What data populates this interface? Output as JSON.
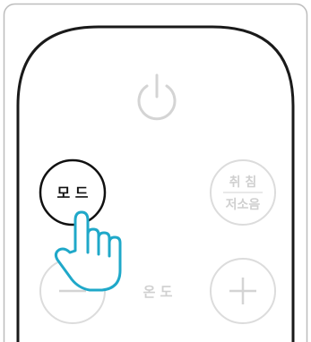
{
  "remote": {
    "mode_button_label": "모 드",
    "sleep_label": "취 침",
    "quiet_label": "저소음",
    "temperature_label": "온 도",
    "icons": {
      "power": "power-icon",
      "minus": "minus-icon",
      "plus": "plus-icon",
      "pointer": "pointing-hand-icon"
    }
  },
  "colors": {
    "frame_border": "#bdbdbd",
    "remote_outline": "#1a1a1a",
    "faded_button": "#dcdcdc",
    "faded_text": "#d0d0d0",
    "active_outline": "#111111",
    "hand_outline": "#1fa8c9"
  }
}
